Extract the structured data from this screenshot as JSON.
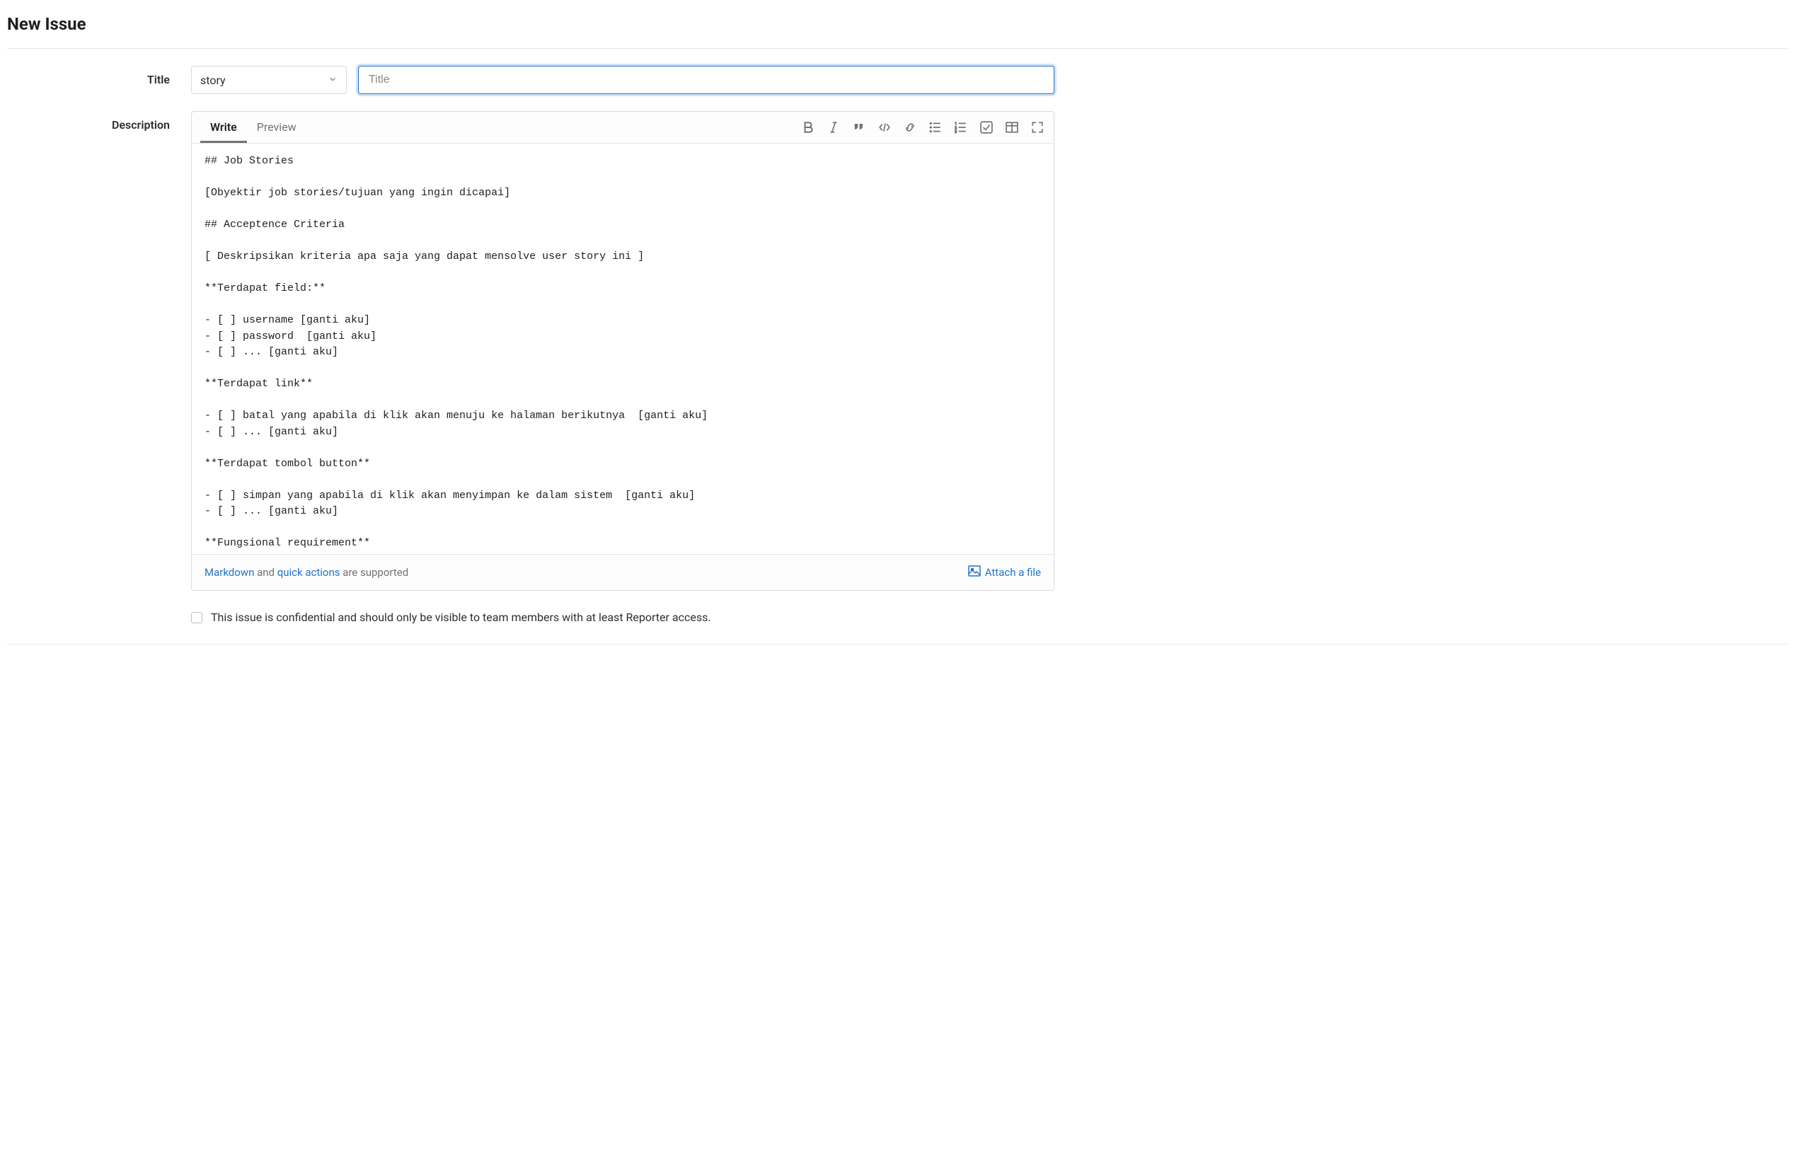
{
  "page": {
    "title": "New Issue"
  },
  "form": {
    "title_label": "Title",
    "template_selected": "story",
    "title_placeholder": "Title",
    "title_value": "",
    "description_label": "Description"
  },
  "editor": {
    "tabs": {
      "write": "Write",
      "preview": "Preview"
    },
    "body": "## Job Stories\n\n[Obyektir job stories/tujuan yang ingin dicapai]\n\n## Acceptence Criteria\n\n[ Deskripsikan kriteria apa saja yang dapat mensolve user story ini ]\n\n**Terdapat field:**\n\n- [ ] username [ganti aku]\n- [ ] password  [ganti aku]\n- [ ] ... [ganti aku]\n\n**Terdapat link**\n\n- [ ] batal yang apabila di klik akan menuju ke halaman berikutnya  [ganti aku]\n- [ ] ... [ganti aku]\n\n**Terdapat tombol button**\n\n- [ ] simpan yang apabila di klik akan menyimpan ke dalam sistem  [ganti aku]\n- [ ] ... [ganti aku]\n\n**Fungsional requirement**",
    "footer": {
      "markdown_link": "Markdown",
      "and_text": " and ",
      "quick_actions_link": "quick actions",
      "supported_text": " are supported",
      "attach_label": "Attach a file"
    }
  },
  "confidential": {
    "label": "This issue is confidential and should only be visible to team members with at least Reporter access."
  }
}
